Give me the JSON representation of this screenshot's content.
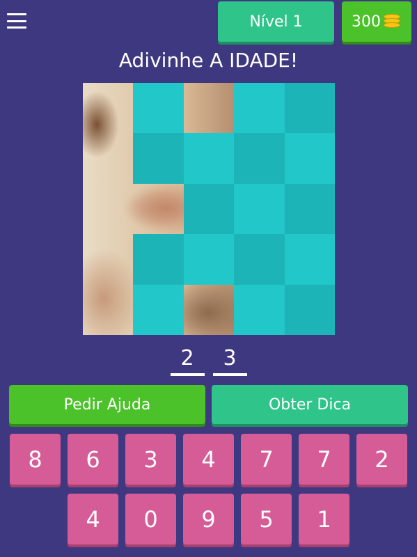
{
  "header": {
    "menu_icon": "hamburger-menu-icon",
    "level_label": "Nível 1",
    "coins": "300",
    "coin_icon": "coin-stack-icon"
  },
  "title": "Adivinhe A IDADE!",
  "answer": [
    "2",
    "3"
  ],
  "actions": {
    "help_label": "Pedir Ajuda",
    "hint_label": "Obter Dica"
  },
  "keyboard": {
    "row1": [
      "8",
      "6",
      "3",
      "4",
      "7",
      "7",
      "2"
    ],
    "row2": [
      "4",
      "0",
      "9",
      "5",
      "1"
    ]
  },
  "colors": {
    "background": "#3e3880",
    "tile": "#22c7c9",
    "green_button": "#4bc12a",
    "teal_button": "#2ec48a",
    "key": "#d65c98"
  }
}
